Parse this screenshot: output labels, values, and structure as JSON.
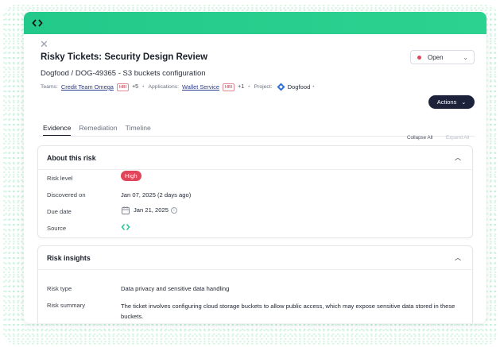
{
  "header": {
    "title": "Risky Tickets: Security Design Review",
    "subtitle": "Dogfood / DOG-49365 - S3 buckets configuration",
    "status": "Open",
    "actions_label": "Actions",
    "close_icon": "close-icon",
    "logo_icon": "code-brackets-icon"
  },
  "meta": {
    "teams_label": "Teams:",
    "team_name": "Credit Team Omega",
    "team_badge": "HBI",
    "team_more": "+5",
    "apps_label": "Applications:",
    "app_name": "Wallet Service",
    "app_badge": "HBI",
    "app_more": "+1",
    "project_label": "Project:",
    "project_name": "Dogfood",
    "sep": "•"
  },
  "tabs": [
    {
      "label": "Evidence",
      "active": true
    },
    {
      "label": "Remediation",
      "active": false
    },
    {
      "label": "Timeline",
      "active": false
    }
  ],
  "controls": {
    "collapse_all": "Collapse All",
    "expand_all": "Expand All"
  },
  "about": {
    "title": "About this risk",
    "rows": {
      "risk_level_label": "Risk level",
      "risk_level_value": "High",
      "discovered_label": "Discovered on",
      "discovered_value": "Jan 07, 2025 (2 days ago)",
      "due_label": "Due date",
      "due_value": "Jan 21, 2025",
      "source_label": "Source"
    }
  },
  "insights": {
    "title": "Risk insights",
    "risk_type_label": "Risk type",
    "risk_type_value": "Data privacy and sensitive data handling",
    "risk_summary_label": "Risk summary",
    "risk_summary_value": "The ticket involves configuring cloud storage buckets to allow public access, which may expose sensitive data stored in these buckets."
  },
  "colors": {
    "accent_green": "#22c98a",
    "danger": "#e0455a",
    "dark_button": "#1c2239"
  }
}
